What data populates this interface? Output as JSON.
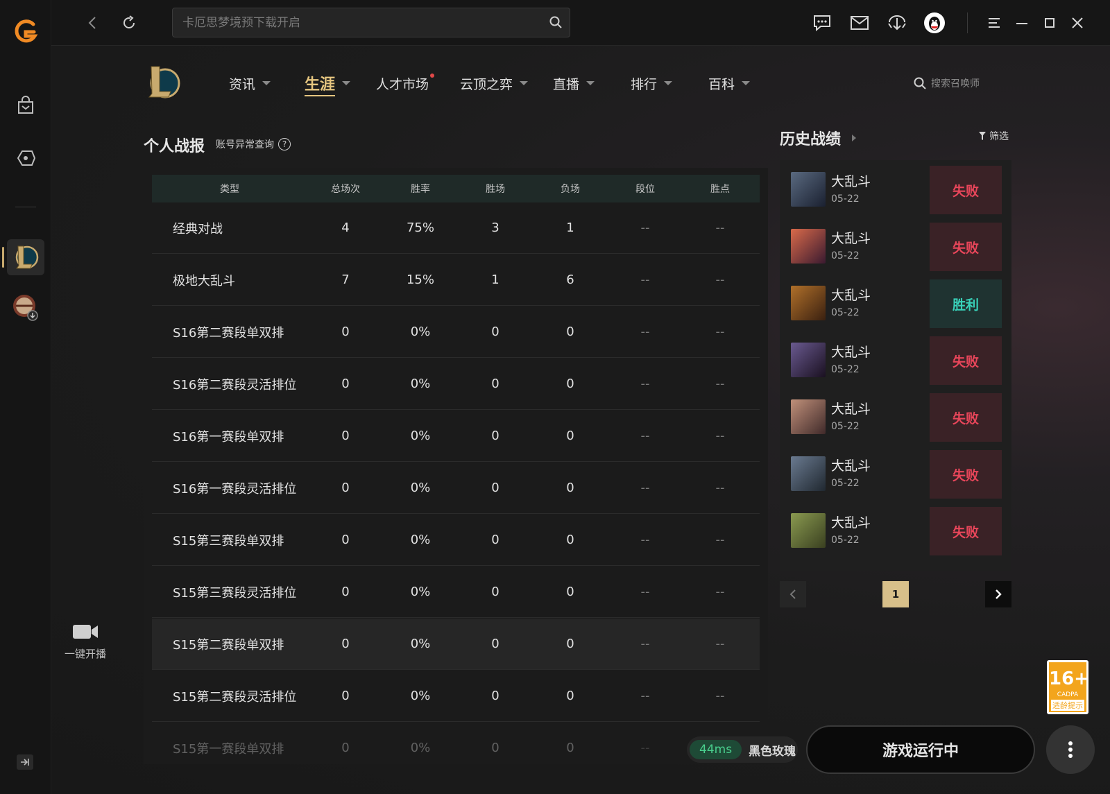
{
  "topbar": {
    "search_placeholder": "卡厄思梦境预下载开启"
  },
  "game_nav": {
    "items": [
      {
        "label": "资讯"
      },
      {
        "label": "生涯"
      },
      {
        "label": "人才市场"
      },
      {
        "label": "云顶之弈"
      },
      {
        "label": "直播"
      },
      {
        "label": "排行"
      },
      {
        "label": "百科"
      }
    ],
    "active_index": 1,
    "summoner_search_placeholder": "搜索召唤师"
  },
  "sidebar": {
    "stream_label": "一键开播"
  },
  "stats": {
    "title": "个人战报",
    "account_link": "账号异常查询",
    "help_symbol": "?",
    "columns": [
      "类型",
      "总场次",
      "胜率",
      "胜场",
      "负场",
      "段位",
      "胜点"
    ],
    "rows": [
      [
        "经典对战",
        "4",
        "75%",
        "3",
        "1",
        "--",
        "--"
      ],
      [
        "极地大乱斗",
        "7",
        "15%",
        "1",
        "6",
        "--",
        "--"
      ],
      [
        "S16第二赛段单双排",
        "0",
        "0%",
        "0",
        "0",
        "--",
        "--"
      ],
      [
        "S16第二赛段灵活排位",
        "0",
        "0%",
        "0",
        "0",
        "--",
        "--"
      ],
      [
        "S16第一赛段单双排",
        "0",
        "0%",
        "0",
        "0",
        "--",
        "--"
      ],
      [
        "S16第一赛段灵活排位",
        "0",
        "0%",
        "0",
        "0",
        "--",
        "--"
      ],
      [
        "S15第三赛段单双排",
        "0",
        "0%",
        "0",
        "0",
        "--",
        "--"
      ],
      [
        "S15第三赛段灵活排位",
        "0",
        "0%",
        "0",
        "0",
        "--",
        "--"
      ],
      [
        "S15第二赛段单双排",
        "0",
        "0%",
        "0",
        "0",
        "--",
        "--"
      ],
      [
        "S15第二赛段灵活排位",
        "0",
        "0%",
        "0",
        "0",
        "--",
        "--"
      ],
      [
        "S15第一赛段单双排",
        "0",
        "0%",
        "0",
        "0",
        "--",
        "--"
      ]
    ]
  },
  "history": {
    "title": "历史战绩",
    "filter_label": "筛选",
    "matches": [
      {
        "mode": "大乱斗",
        "date": "05-22",
        "result": "失败"
      },
      {
        "mode": "大乱斗",
        "date": "05-22",
        "result": "失败"
      },
      {
        "mode": "大乱斗",
        "date": "05-22",
        "result": "胜利"
      },
      {
        "mode": "大乱斗",
        "date": "05-22",
        "result": "失败"
      },
      {
        "mode": "大乱斗",
        "date": "05-22",
        "result": "失败"
      },
      {
        "mode": "大乱斗",
        "date": "05-22",
        "result": "失败"
      },
      {
        "mode": "大乱斗",
        "date": "05-22",
        "result": "失败"
      }
    ],
    "page": "1"
  },
  "age_rating": {
    "age": "16+",
    "org": "CADPA",
    "label": "适龄提示"
  },
  "bottom": {
    "ping": "44ms",
    "server": "黑色玫瑰",
    "launch_label": "游戏运行中"
  },
  "colors": {
    "accent_gold": "#e6c680",
    "lose": "#e8465a",
    "win": "#39d0b8",
    "ping_green": "#4ad08e"
  }
}
